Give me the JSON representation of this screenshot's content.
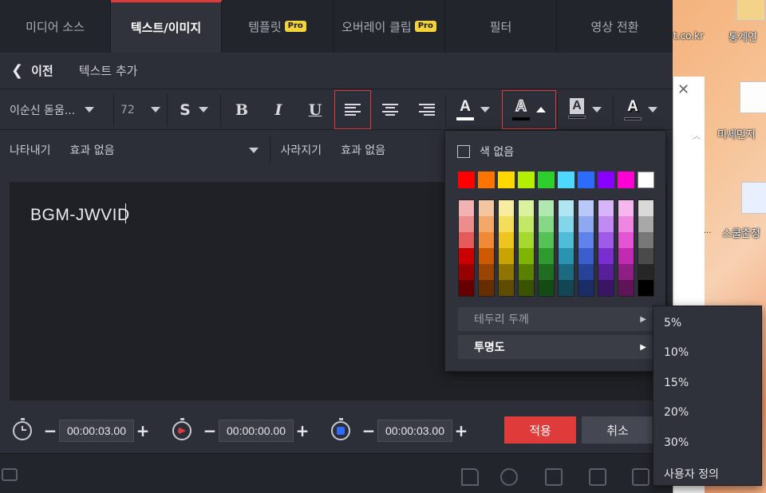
{
  "tabs": [
    {
      "label": "미디어 소스",
      "pro": false,
      "active": false
    },
    {
      "label": "텍스트/이미지",
      "pro": false,
      "active": true
    },
    {
      "label": "템플릿",
      "pro": true,
      "active": false
    },
    {
      "label": "오버레이 클립",
      "pro": true,
      "active": false
    },
    {
      "label": "필터",
      "pro": false,
      "active": false
    },
    {
      "label": "영상 전환",
      "pro": false,
      "active": false
    }
  ],
  "pro_badge": "Pro",
  "header": {
    "back_label": "이전",
    "title": "텍스트 추가"
  },
  "toolbar": {
    "font_name": "이순신 돋움...",
    "font_size": "72",
    "style_label": "S",
    "bold": "B",
    "italic": "I",
    "underline": "U",
    "text_color_glyph": "A",
    "outline_color_glyph": "A",
    "bg_color_glyph": "A",
    "shadow_color_glyph": "A"
  },
  "effects": {
    "appear_label": "나타내기",
    "appear_value": "효과 없음",
    "disappear_label": "사라지기",
    "disappear_value": "효과 없음"
  },
  "editor": {
    "text": "BGM-JWVID"
  },
  "timing": {
    "start_time": "00:00:03.00",
    "duration_time": "00:00:00.00",
    "end_time": "00:00:03.00",
    "minus": "−",
    "plus": "+"
  },
  "actions": {
    "apply": "적용",
    "cancel": "취소"
  },
  "color_popup": {
    "no_color_label": "색 없음",
    "basic_colors": [
      "#ff0000",
      "#ff7300",
      "#ffd800",
      "#b4ef00",
      "#2ccf2c",
      "#4ed8ff",
      "#2d6bff",
      "#8a00ff",
      "#ff00d4",
      "#ffffff"
    ],
    "gradient_columns": [
      [
        "#f2b2b2",
        "#ec8c8c",
        "#e55b5b",
        "#cc0000",
        "#990000",
        "#660000"
      ],
      [
        "#f4c6a0",
        "#f3a86a",
        "#f08a36",
        "#cc5a00",
        "#994400",
        "#662d00"
      ],
      [
        "#f7eca0",
        "#f3dd5a",
        "#eec51e",
        "#c9a300",
        "#8f7400",
        "#5e4c00"
      ],
      [
        "#daf2a0",
        "#c2e866",
        "#a5d932",
        "#7fb500",
        "#5a8000",
        "#3a5300"
      ],
      [
        "#b0e8b0",
        "#86d886",
        "#54c254",
        "#2f9b2f",
        "#1f6e1f",
        "#144a14"
      ],
      [
        "#b0e6f2",
        "#84d5ea",
        "#4fbcd8",
        "#2a93b0",
        "#1c6a80",
        "#124655"
      ],
      [
        "#b8c8f8",
        "#8ea8f2",
        "#5f83ea",
        "#3a5fcc",
        "#274399",
        "#1a2d66"
      ],
      [
        "#d8b4f8",
        "#c08af2",
        "#a05ae8",
        "#7a2ecf",
        "#57209a",
        "#3a1566"
      ],
      [
        "#f6b6ee",
        "#ef86e2",
        "#e454d4",
        "#c22ab2",
        "#8f1f84",
        "#5e1457"
      ],
      [
        "#d9d9d9",
        "#a8a8a8",
        "#787878",
        "#4a4a4a",
        "#262626",
        "#000000"
      ]
    ],
    "border_thickness_label": "테두리 두께",
    "opacity_label": "투명도"
  },
  "opacity_menu": [
    "5%",
    "10%",
    "15%",
    "20%",
    "30%",
    "사용자 정의"
  ],
  "desktop": {
    "site_fragment": "t.co.kr",
    "icon_labels": [
      "통계연",
      "미세먼지",
      "스쿨존정"
    ],
    "ellipsis": "..."
  }
}
